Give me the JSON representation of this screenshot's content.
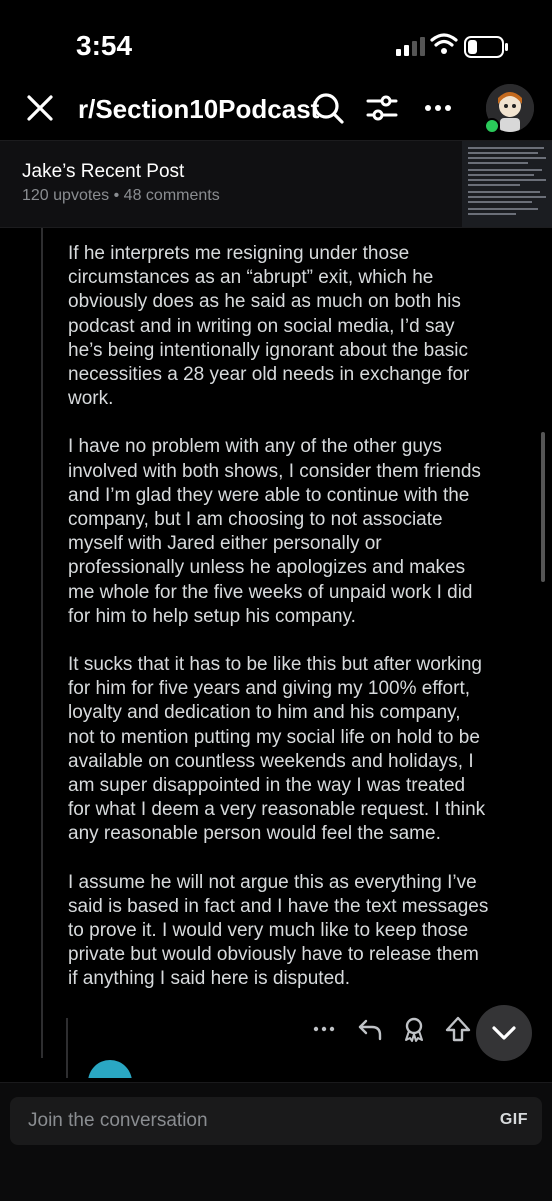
{
  "status_bar": {
    "time": "3:54"
  },
  "nav": {
    "subreddit": "r/Section10Podcast"
  },
  "post": {
    "title": "Jake’s Recent Post",
    "meta": "120 upvotes • 48 comments"
  },
  "comment": {
    "paragraphs": [
      "If he interprets me resigning under those\ncircumstances as an “abrupt” exit, which he\nobviously does as he said as much on both his\npodcast and in writing on social media, I’d say\nhe’s being intentionally ignorant about the basic\nnecessities a 28 year old needs in exchange for\nwork.",
      "I have no problem with any of the other guys\ninvolved with both shows, I consider them friends\nand I’m glad they were able to continue with the\ncompany, but I am choosing to not associate\nmyself with Jared either personally or\nprofessionally unless he apologizes and makes\nme whole for the five weeks of unpaid work I did\nfor him to help setup his company.",
      "It sucks that it has to be like this but after working\nfor him for five years and giving my 100% effort,\nloyalty and dedication to him and his company,\nnot to mention putting my social life on hold to be\navailable on countless weekends and holidays, I\nam super disappointed in the way I was treated\nfor what I deem a very reasonable request. I think\nany reasonable person would feel the same.",
      "I assume he will not argue this as everything I’ve\nsaid is based in fact and I have the text messages\nto prove it. I would very much like to keep those\nprivate but would obviously have to release them\nif anything I said here is disputed."
    ]
  },
  "composer": {
    "placeholder": "Join the conversation",
    "gif_label": "GIF"
  },
  "icons": [
    "close-icon",
    "search-icon",
    "sort-icon",
    "more-icon",
    "reply-icon",
    "award-icon",
    "upvote-icon",
    "chevron-down-icon"
  ]
}
